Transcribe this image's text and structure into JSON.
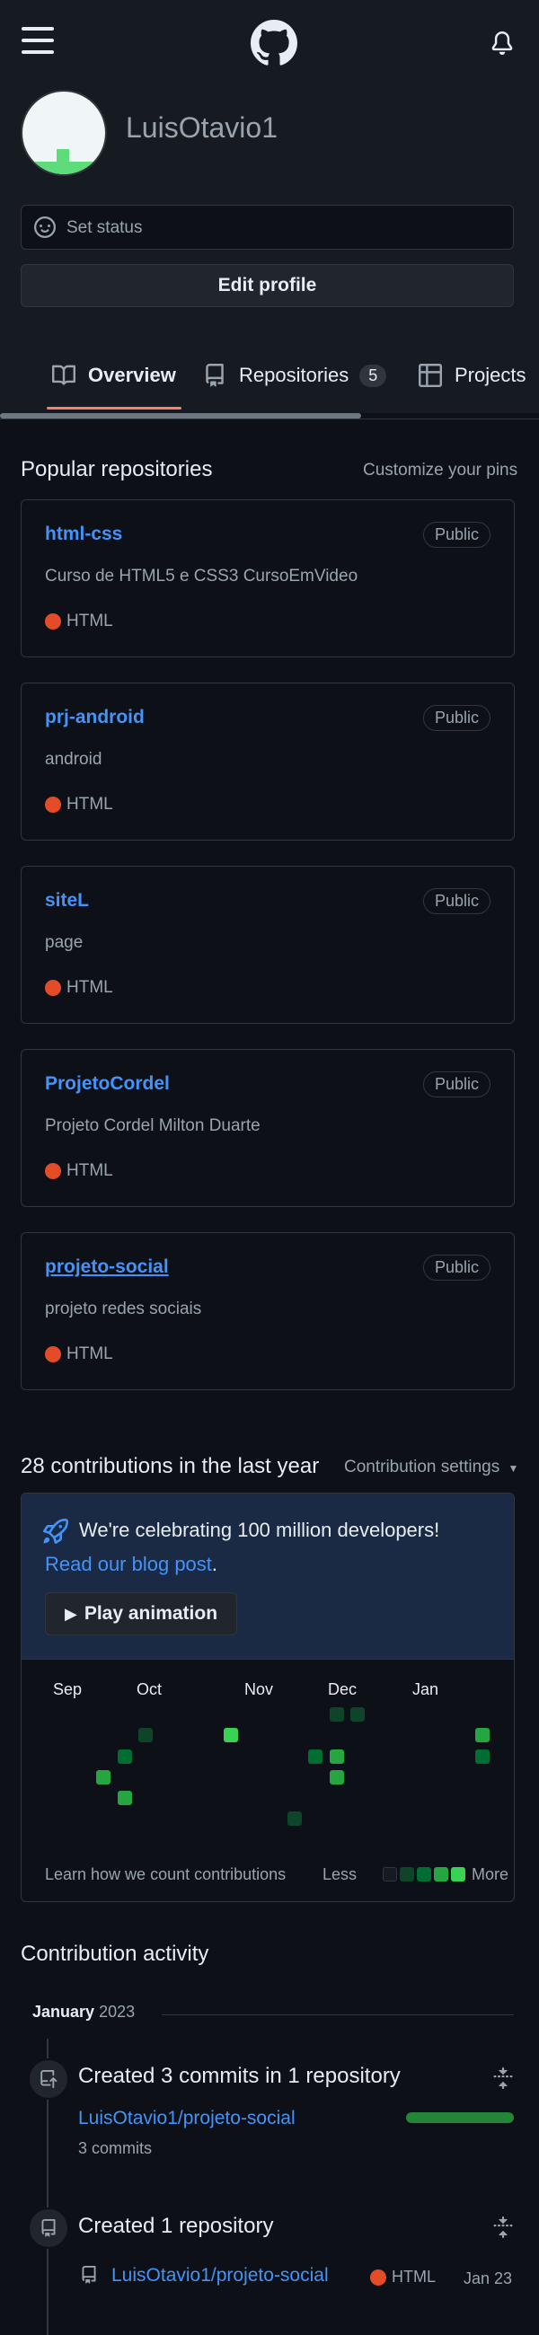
{
  "header": {
    "menu_icon": "hamburger-icon",
    "logo_icon": "github-mark-icon",
    "notifications_icon": "bell-icon"
  },
  "profile": {
    "username": "LuisOtavio1",
    "status_placeholder": "Set status",
    "edit_profile_label": "Edit profile"
  },
  "tabs": [
    {
      "label": "Overview",
      "icon": "book-icon",
      "selected": true
    },
    {
      "label": "Repositories",
      "icon": "repo-icon",
      "count": "5"
    },
    {
      "label": "Projects",
      "icon": "table-icon"
    }
  ],
  "pinned": {
    "title": "Popular repositories",
    "customize_label": "Customize your pins",
    "repos": [
      {
        "name": "html-css",
        "visibility": "Public",
        "description": "Curso de HTML5 e CSS3 CursoEmVideo",
        "language": "HTML"
      },
      {
        "name": "prj-android",
        "visibility": "Public",
        "description": "android",
        "language": "HTML"
      },
      {
        "name": "siteL",
        "visibility": "Public",
        "description": "page",
        "language": "HTML"
      },
      {
        "name": "ProjetoCordel",
        "visibility": "Public",
        "description": "Projeto Cordel Milton Duarte",
        "language": "HTML"
      },
      {
        "name": "projeto-social",
        "visibility": "Public",
        "description": "projeto redes sociais",
        "language": "HTML"
      }
    ],
    "language_color": "#e34c26"
  },
  "contributions": {
    "title": "28 contributions in the last year",
    "settings_label": "Contribution settings",
    "celebrate_text": "We're celebrating 100 million developers!",
    "blog_link": "Read our blog post",
    "blog_period": ".",
    "play_label": "Play animation",
    "months": [
      "Sep",
      "Oct",
      "Nov",
      "Dec",
      "Jan"
    ],
    "learn_link": "Learn how we count contributions",
    "less_label": "Less",
    "more_label": "More"
  },
  "activity": {
    "title": "Contribution activity",
    "month": "January",
    "year": "2023",
    "items": [
      {
        "heading": "Created 3 commits in 1 repository",
        "repo": "LuisOtavio1/projeto-social",
        "sub": "3 commits",
        "icon": "repo-push-icon"
      },
      {
        "heading": "Created 1 repository",
        "repo": "LuisOtavio1/projeto-social",
        "language": "HTML",
        "date": "Jan 23",
        "icon": "repo-icon"
      }
    ]
  }
}
